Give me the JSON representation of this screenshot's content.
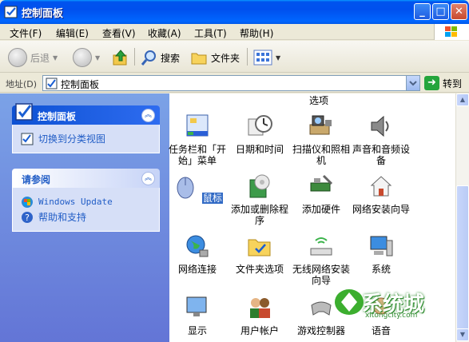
{
  "window": {
    "title": "控制面板"
  },
  "title_buttons": {
    "minimize": "_",
    "maximize": "□",
    "close": "✕"
  },
  "menu": [
    {
      "label": "文件(F)"
    },
    {
      "label": "编辑(E)"
    },
    {
      "label": "查看(V)"
    },
    {
      "label": "收藏(A)"
    },
    {
      "label": "工具(T)"
    },
    {
      "label": "帮助(H)"
    }
  ],
  "toolbar": {
    "back": "后退",
    "search": "搜索",
    "folders": "文件夹"
  },
  "address": {
    "label": "地址(D)",
    "value": "控制面板",
    "go": "转到"
  },
  "sidebar": {
    "main_panel": {
      "title": "控制面板",
      "links": [
        "切换到分类视图"
      ]
    },
    "see_also": {
      "title": "请参阅",
      "links": [
        "Windows Update",
        "帮助和支持"
      ]
    }
  },
  "content": {
    "top_partial_label": "选项",
    "items": [
      {
        "label": "任务栏和「开始」菜单",
        "icon": "taskbar-icon"
      },
      {
        "label": "日期和时间",
        "icon": "clock-icon"
      },
      {
        "label": "扫描仪和照相机",
        "icon": "scanner-icon"
      },
      {
        "label": "声音和音频设备",
        "icon": "speaker-icon"
      },
      {
        "label": "鼠标",
        "icon": "mouse-icon",
        "selected": true
      },
      {
        "label": "添加或删除程序",
        "icon": "add-remove-programs-icon"
      },
      {
        "label": "添加硬件",
        "icon": "hardware-icon"
      },
      {
        "label": "网络安装向导",
        "icon": "network-setup-icon"
      },
      {
        "label": "网络连接",
        "icon": "network-globe-icon"
      },
      {
        "label": "文件夹选项",
        "icon": "folder-options-icon"
      },
      {
        "label": "无线网络安装向导",
        "icon": "wireless-icon"
      },
      {
        "label": "系统",
        "icon": "system-icon"
      },
      {
        "label": "显示",
        "icon": "display-icon"
      },
      {
        "label": "用户帐户",
        "icon": "users-icon"
      },
      {
        "label": "游戏控制器",
        "icon": "gamepad-icon"
      },
      {
        "label": "语音",
        "icon": "speech-icon"
      }
    ]
  },
  "watermark": {
    "text": "系统城",
    "subtext": "xitongcity.com"
  }
}
